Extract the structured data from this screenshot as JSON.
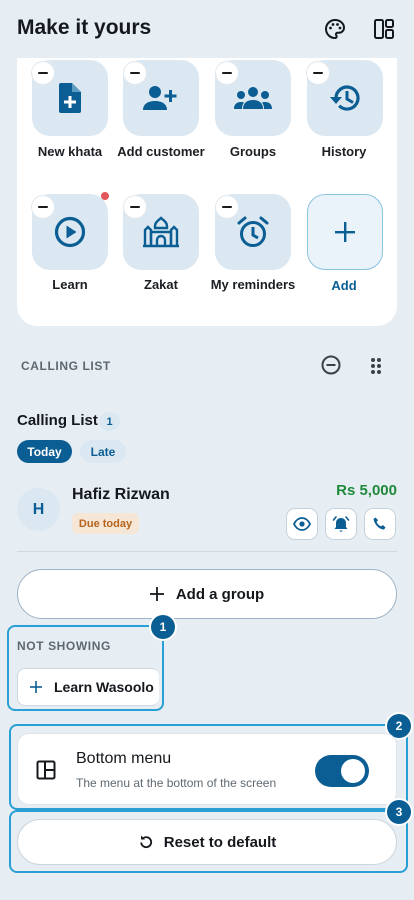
{
  "header": {
    "title": "Make it yours",
    "icons": [
      "palette-icon",
      "layout-icon"
    ]
  },
  "shortcuts": {
    "items": [
      {
        "label": "New khata",
        "icon": "new-document-icon"
      },
      {
        "label": "Add customer",
        "icon": "add-person-icon"
      },
      {
        "label": "Groups",
        "icon": "group-icon"
      },
      {
        "label": "History",
        "icon": "history-icon"
      },
      {
        "label": "Learn",
        "icon": "play-circle-icon"
      },
      {
        "label": "Zakat",
        "icon": "mosque-icon"
      },
      {
        "label": "My reminders",
        "icon": "alarm-icon"
      }
    ],
    "add_label": "Add"
  },
  "calling_section": {
    "title": "CALLING LIST",
    "list_title": "Calling List",
    "count": "1",
    "tabs": [
      "Today",
      "Late"
    ],
    "customer": {
      "initial": "H",
      "name": "Hafiz Rizwan",
      "status": "Due today",
      "amount": "Rs 5,000"
    }
  },
  "add_group_label": "Add a group",
  "not_showing": {
    "title": "NOT SHOWING",
    "item_label": "Learn Wasoolo"
  },
  "bottom_menu": {
    "title": "Bottom menu",
    "subtitle": "The menu at the bottom of the screen",
    "enabled": true
  },
  "reset_label": "Reset to default",
  "highlights": [
    "1",
    "2",
    "3"
  ],
  "colors": {
    "primary": "#0b5e93",
    "highlight": "#2a9fd6",
    "amount": "#1f8a3b",
    "background": "#e6edf3"
  }
}
